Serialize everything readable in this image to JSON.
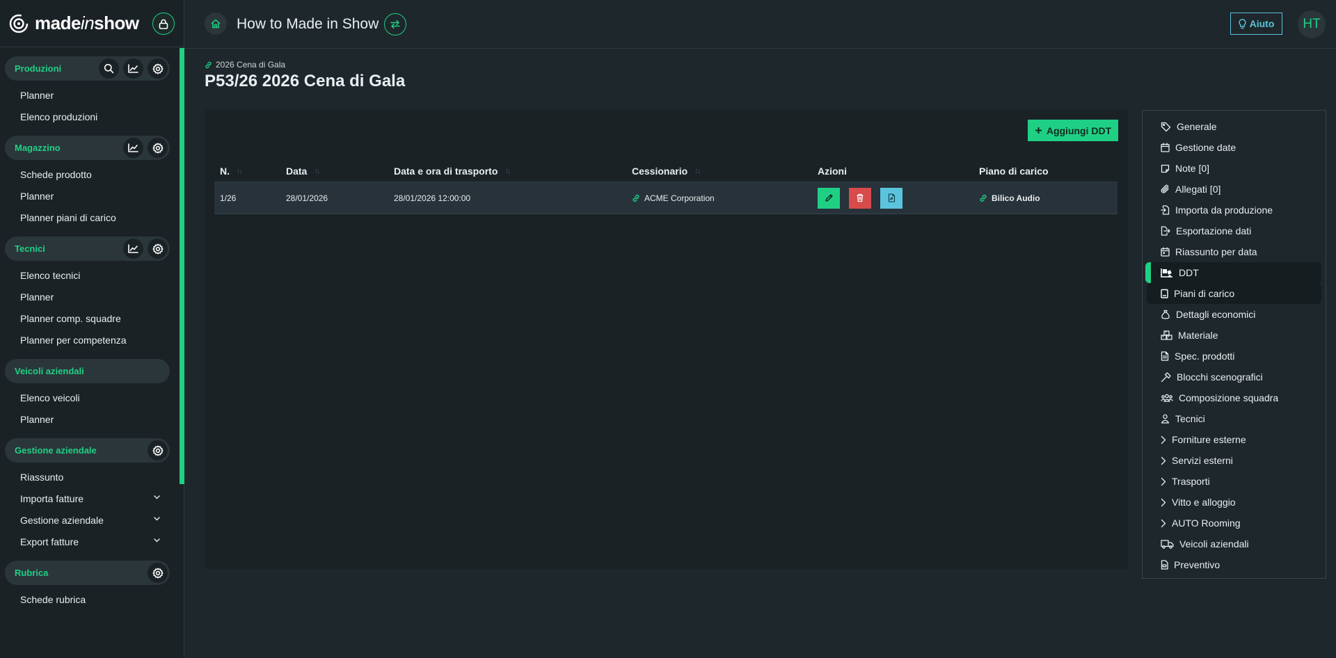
{
  "brand": {
    "logo_prefix": "made",
    "logo_italic": "in",
    "logo_suffix": "show"
  },
  "colors": {
    "accent": "#1fd084",
    "danger": "#d84b4b",
    "info": "#5bc4dc",
    "background": "#1e272b",
    "sidebar": "#1b2226"
  },
  "header": {
    "title": "How to Made in Show",
    "help_label": "Aiuto",
    "avatar_initials": "HT"
  },
  "sidebar": {
    "sections": [
      {
        "title": "Produzioni",
        "actions": [
          "search-icon",
          "chart-icon",
          "gear-icon"
        ],
        "items": [
          "Planner",
          "Elenco produzioni"
        ]
      },
      {
        "title": "Magazzino",
        "actions": [
          "chart-icon",
          "gear-icon"
        ],
        "items": [
          "Schede prodotto",
          "Planner",
          "Planner piani di carico"
        ]
      },
      {
        "title": "Tecnici",
        "actions": [
          "chart-icon",
          "gear-icon"
        ],
        "items": [
          "Elenco tecnici",
          "Planner",
          "Planner comp. squadre",
          "Planner per competenza"
        ]
      },
      {
        "title": "Veicoli aziendali",
        "actions": [],
        "items": [
          "Elenco veicoli",
          "Planner"
        ]
      },
      {
        "title": "Gestione aziendale",
        "actions": [
          "gear-icon"
        ],
        "items": [
          "Riassunto",
          "Importa fatture",
          "Gestione aziendale",
          "Export fatture"
        ]
      },
      {
        "title": "Rubrica",
        "actions": [
          "gear-icon"
        ],
        "items": [
          "Schede rubrica"
        ]
      }
    ]
  },
  "page": {
    "breadcrumb": "2026 Cena di Gala",
    "title": "P53/26 2026 Cena di Gala",
    "add_button": "Aggiungi DDT"
  },
  "table": {
    "headers": [
      "N.",
      "Data",
      "Data e ora di trasporto",
      "Cessionario",
      "Azioni",
      "Piano di carico"
    ],
    "rows": [
      {
        "n": "1/26",
        "data": "28/01/2026",
        "trasporto": "28/01/2026 12:00:00",
        "cessionario": "ACME Corporation",
        "piano": "Bilico Audio"
      }
    ]
  },
  "right_nav": {
    "items": [
      {
        "label": "Generale",
        "icon": "tag-icon"
      },
      {
        "label": "Gestione date",
        "icon": "calendar-icon"
      },
      {
        "label": "Note [0]",
        "icon": "note-icon"
      },
      {
        "label": "Allegati [0]",
        "icon": "paperclip-icon"
      },
      {
        "label": "Importa da produzione",
        "icon": "file-import-icon"
      },
      {
        "label": "Esportazione dati",
        "icon": "file-export-icon"
      },
      {
        "label": "Riassunto per data",
        "icon": "calendar-day-icon"
      },
      {
        "label": "DDT",
        "icon": "truck-ramp-icon"
      },
      {
        "label": "Piani di carico",
        "icon": "clipboard-icon"
      },
      {
        "label": "Dettagli economici",
        "icon": "money-bag-icon"
      },
      {
        "label": "Materiale",
        "icon": "boxes-icon"
      },
      {
        "label": "Spec. prodotti",
        "icon": "file-lines-icon"
      },
      {
        "label": "Blocchi scenografici",
        "icon": "hammer-icon"
      },
      {
        "label": "Composizione squadra",
        "icon": "users-icon"
      },
      {
        "label": "Tecnici",
        "icon": "user-icon"
      },
      {
        "label": "Forniture esterne",
        "icon": "chevron-right-icon"
      },
      {
        "label": "Servizi esterni",
        "icon": "chevron-right-icon"
      },
      {
        "label": "Trasporti",
        "icon": "chevron-right-icon"
      },
      {
        "label": "Vitto e alloggio",
        "icon": "chevron-right-icon"
      },
      {
        "label": "AUTO Rooming",
        "icon": "chevron-right-icon"
      },
      {
        "label": "Veicoli aziendali",
        "icon": "truck-icon"
      },
      {
        "label": "Preventivo",
        "icon": "file-invoice-icon"
      }
    ]
  }
}
